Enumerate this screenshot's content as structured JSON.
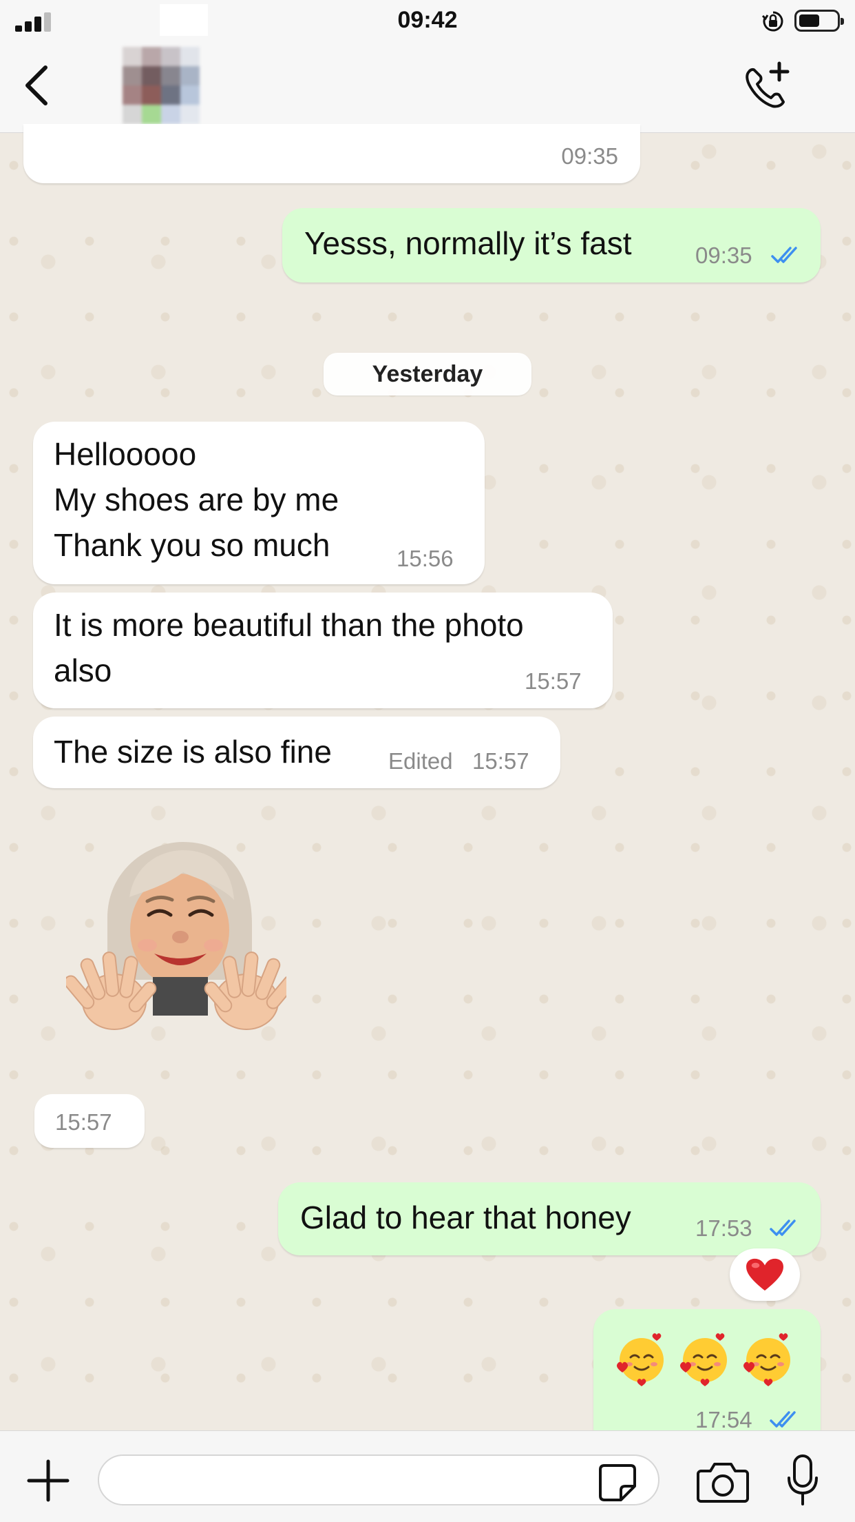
{
  "status_bar": {
    "time": "09:42",
    "signal_bars": 3,
    "battery_level": 0.55
  },
  "header": {
    "back_icon": "chevron-left-icon",
    "avatar": "blurred-avatar",
    "contact_name": "",
    "call_icon": "add-call-icon"
  },
  "messages": [
    {
      "direction": "in",
      "text": "",
      "time": "09:35"
    },
    {
      "direction": "out",
      "text": "Yesss, normally it’s fast",
      "time": "09:35",
      "read": true
    },
    {
      "direction": "in",
      "text": "Hellooooo\nMy shoes are by me\nThank you so much",
      "time": "15:56"
    },
    {
      "direction": "in",
      "text": "It is more beautiful than the photo\nalso",
      "time": "15:57"
    },
    {
      "direction": "in",
      "text": "The size is also fine",
      "edited_label": "Edited",
      "time": "15:57"
    },
    {
      "direction": "in",
      "type": "sticker",
      "sticker": "memoji-waving-hands",
      "time": "15:57"
    },
    {
      "direction": "out",
      "text": "Glad to hear that honey",
      "time": "17:53",
      "read": true,
      "reaction": "❤️"
    },
    {
      "direction": "out",
      "type": "emoji",
      "emoji": [
        "🥰",
        "🥰",
        "🥰"
      ],
      "time": "17:54",
      "read": true
    }
  ],
  "date_separator": "Yesterday",
  "input_bar": {
    "attach_icon": "plus-icon",
    "placeholder": "",
    "sticker_icon": "sticker-icon",
    "camera_icon": "camera-icon",
    "mic_icon": "microphone-icon"
  },
  "colors": {
    "incoming_bubble": "#ffffff",
    "outgoing_bubble": "#d9fdd3",
    "background": "#efeae2",
    "read_ticks": "#3d8ff0",
    "timestamp": "#8a8a8a"
  }
}
